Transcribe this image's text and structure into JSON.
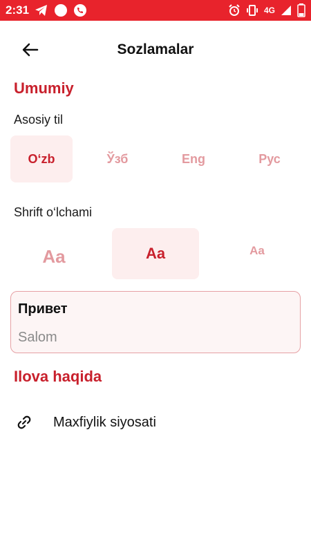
{
  "status_bar": {
    "time": "2:31",
    "network": "4G",
    "accent_color": "#e8232c",
    "left_icons": [
      "telegram-icon",
      "circle-notification-icon",
      "phone-icon"
    ],
    "right_icons": [
      "alarm-icon",
      "vibrate-icon",
      "signal-icon",
      "battery-icon"
    ]
  },
  "header": {
    "title": "Sozlamalar",
    "back_icon": "arrow-left-icon"
  },
  "general": {
    "title": "Umumiy",
    "language": {
      "label": "Asosiy til",
      "options": [
        "O‘zb",
        "Ўзб",
        "Eng",
        "Рус"
      ],
      "selected": "O‘zb"
    },
    "font_size": {
      "label": "Shrift o‘lchami",
      "options": [
        "Aa",
        "Aa",
        "Aa"
      ],
      "selected_index": 1
    },
    "preview": {
      "title": "Привет",
      "subtitle": "Salom"
    }
  },
  "about": {
    "title": "Ilova haqida",
    "items": [
      {
        "label": "Maxfiylik siyosati",
        "icon": "link-icon"
      }
    ]
  },
  "colors": {
    "accent": "#c8202c",
    "accent_light": "#e39a9f",
    "selected_bg": "#fdeeee"
  }
}
